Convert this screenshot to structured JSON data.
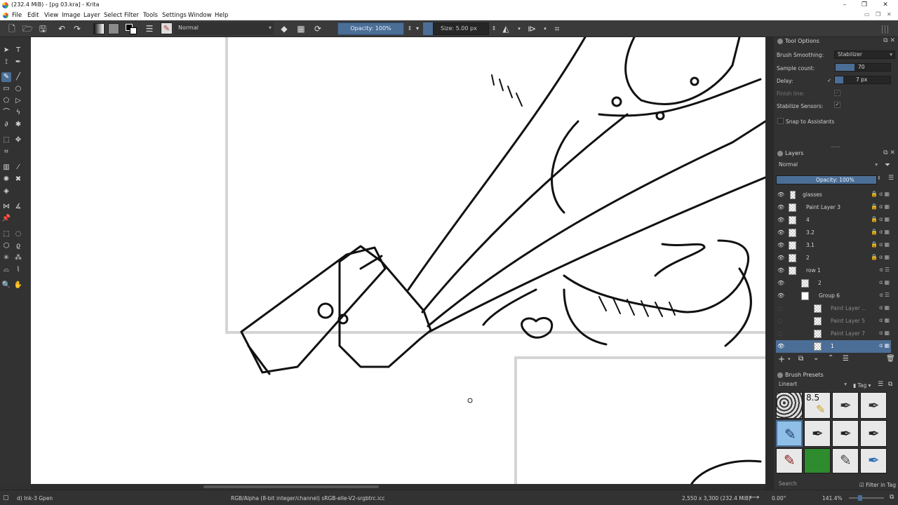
{
  "window": {
    "title": "(232.4 MiB) - [pg 03.kra] - Krita",
    "minimize": "–",
    "maximize": "❐",
    "close": "✕"
  },
  "menu": [
    "File",
    "Edit",
    "View",
    "Image",
    "Layer",
    "Select",
    "Filter",
    "Tools",
    "Settings",
    "Window",
    "Help"
  ],
  "toolbar": {
    "blend_mode": "Normal",
    "opacity": "Opacity: 100%",
    "size": "Size: 5.00 px"
  },
  "tool_options": {
    "title": "Tool Options",
    "brush_smoothing_label": "Brush Smoothing:",
    "brush_smoothing_value": "Stabilizer",
    "sample_count_label": "Sample count:",
    "sample_count_value": "70",
    "delay_label": "Delay:",
    "delay_value": "7 px",
    "finish_line_label": "Finish line:",
    "stabilize_sensors_label": "Stabilize Sensors:",
    "snap_label": "Snap to Assistants"
  },
  "layers": {
    "title": "Layers",
    "blend_mode": "Normal",
    "opacity": "Opacity:  100%",
    "items": [
      {
        "name": "glasses"
      },
      {
        "name": "Paint Layer 3"
      },
      {
        "name": "4"
      },
      {
        "name": "3.2"
      },
      {
        "name": "3.1"
      },
      {
        "name": "2"
      },
      {
        "name": "row 1"
      },
      {
        "name": "2"
      },
      {
        "name": "Group 6"
      },
      {
        "name": "Paint Layer ..."
      },
      {
        "name": "Paint Layer 5"
      },
      {
        "name": "Paint Layer 7"
      },
      {
        "name": "1"
      }
    ]
  },
  "brush_presets": {
    "title": "Brush Presets",
    "tag": "Lineart",
    "tag_button": "Tag",
    "search_placeholder": "Search",
    "filter_label": "Filter in Tag",
    "first_preset_label": "8.5"
  },
  "status": {
    "brush": "d) Ink-3 Gpen",
    "color_space": "RGB/Alpha (8-bit integer/channel)  sRGB-elle-V2-srgbtrc.icc",
    "dimensions": "2,550 x 3,300 (232.4 MiB)",
    "rotation": "0.00°",
    "zoom": "141.4%"
  },
  "colors": {
    "accent": "#4b6e96",
    "panel": "#323232"
  }
}
